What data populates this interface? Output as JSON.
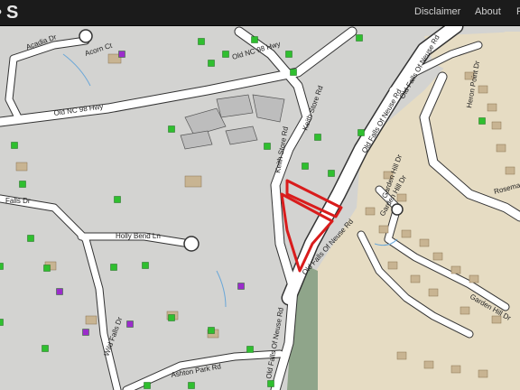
{
  "header": {
    "brand_fragment": "S",
    "nav": [
      "Disclaimer",
      "About",
      "F"
    ]
  },
  "map": {
    "colors": {
      "parcel_fill": "#d3d3d1",
      "parcel_line": "#5a5a5a",
      "road_fill": "#ffffff",
      "road_casing": "#333333",
      "developed_tan": "#e6dcc3",
      "building_tan": "#c8b492",
      "green_strip": "#8fa58a",
      "highlight_red": "#d91c1c",
      "marker_green": "#2fbf2f",
      "marker_purple": "#9b2ccb",
      "water_blue": "#6aa7d8"
    },
    "street_labels": [
      "Acorn Ct",
      "Acadia Dr",
      "Old NC 98 Hwy",
      "Old NC 98 Hwy",
      "Keith Store Rd",
      "Keith Store Rd",
      "Old Falls Of Neuse Rd",
      "Old Falls Of Neuse Rd",
      "Old Falls Of Neuse Rd",
      "Holly Bend Ln",
      "Falls Dr",
      "Wild Falls Dr",
      "Garden Hill Dr",
      "Garden Hill Dr",
      "Garden Hill Dr",
      "Heron Point Dr",
      "Rosemary Ln",
      "Old Falls Of Neuse Rd",
      "Ashton Park Rd"
    ]
  }
}
